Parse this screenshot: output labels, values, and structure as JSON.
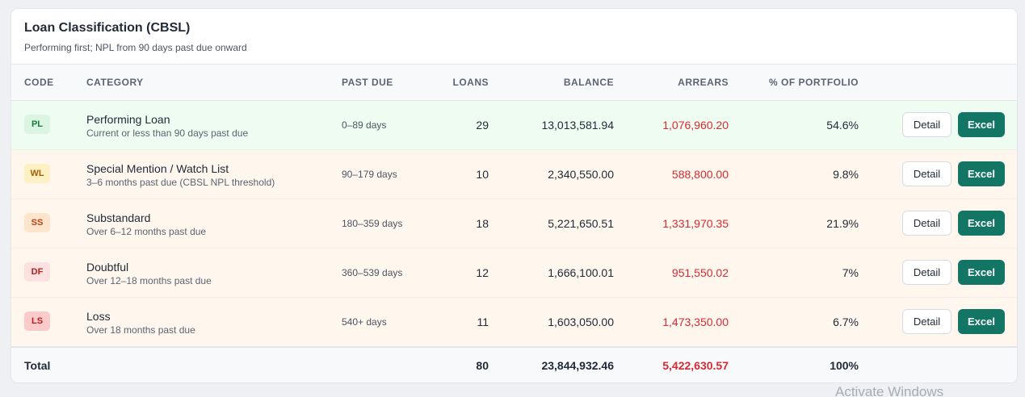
{
  "card": {
    "title": "Loan Classification (CBSL)",
    "subtitle": "Performing first; NPL from 90 days past due onward"
  },
  "columns": {
    "code": "CODE",
    "category": "CATEGORY",
    "past_due": "PAST DUE",
    "loans": "LOANS",
    "balance": "BALANCE",
    "arrears": "ARREARS",
    "pct": "% OF PORTFOLIO"
  },
  "rows": [
    {
      "code": "PL",
      "name": "Performing Loan",
      "description": "Current or less than 90 days past due",
      "past_due": "0–89 days",
      "loans": "29",
      "balance": "13,013,581.94",
      "arrears": "1,076,960.20",
      "pct": "54.6%",
      "detail_label": "Detail",
      "excel_label": "Excel"
    },
    {
      "code": "WL",
      "name": "Special Mention / Watch List",
      "description": "3–6 months past due (CBSL NPL threshold)",
      "past_due": "90–179 days",
      "loans": "10",
      "balance": "2,340,550.00",
      "arrears": "588,800.00",
      "pct": "9.8%",
      "detail_label": "Detail",
      "excel_label": "Excel"
    },
    {
      "code": "SS",
      "name": "Substandard",
      "description": "Over 6–12 months past due",
      "past_due": "180–359 days",
      "loans": "18",
      "balance": "5,221,650.51",
      "arrears": "1,331,970.35",
      "pct": "21.9%",
      "detail_label": "Detail",
      "excel_label": "Excel"
    },
    {
      "code": "DF",
      "name": "Doubtful",
      "description": "Over 12–18 months past due",
      "past_due": "360–539 days",
      "loans": "12",
      "balance": "1,666,100.01",
      "arrears": "951,550.02",
      "pct": "7%",
      "detail_label": "Detail",
      "excel_label": "Excel"
    },
    {
      "code": "LS",
      "name": "Loss",
      "description": "Over 18 months past due",
      "past_due": "540+ days",
      "loans": "11",
      "balance": "1,603,050.00",
      "arrears": "1,473,350.00",
      "pct": "6.7%",
      "detail_label": "Detail",
      "excel_label": "Excel"
    }
  ],
  "total": {
    "label": "Total",
    "loans": "80",
    "balance": "23,844,932.46",
    "arrears": "5,422,630.57",
    "pct": "100%"
  },
  "badge_colors": {
    "PL": {
      "bg": "#dcf5e3",
      "fg": "#15803d"
    },
    "WL": {
      "bg": "#fdf0c2",
      "fg": "#a16207"
    },
    "SS": {
      "bg": "#fde4cc",
      "fg": "#c2410c"
    },
    "DF": {
      "bg": "#fde0e0",
      "fg": "#b91c1c"
    },
    "LS": {
      "bg": "#fbcaca",
      "fg": "#b91c1c"
    }
  },
  "colors": {
    "accent": "#137564",
    "arrears_red": "#d72b33",
    "performing_row_bg": "#effcf1",
    "npl_row_bg": "#fff6ed"
  },
  "watermark": "Activate Windows"
}
